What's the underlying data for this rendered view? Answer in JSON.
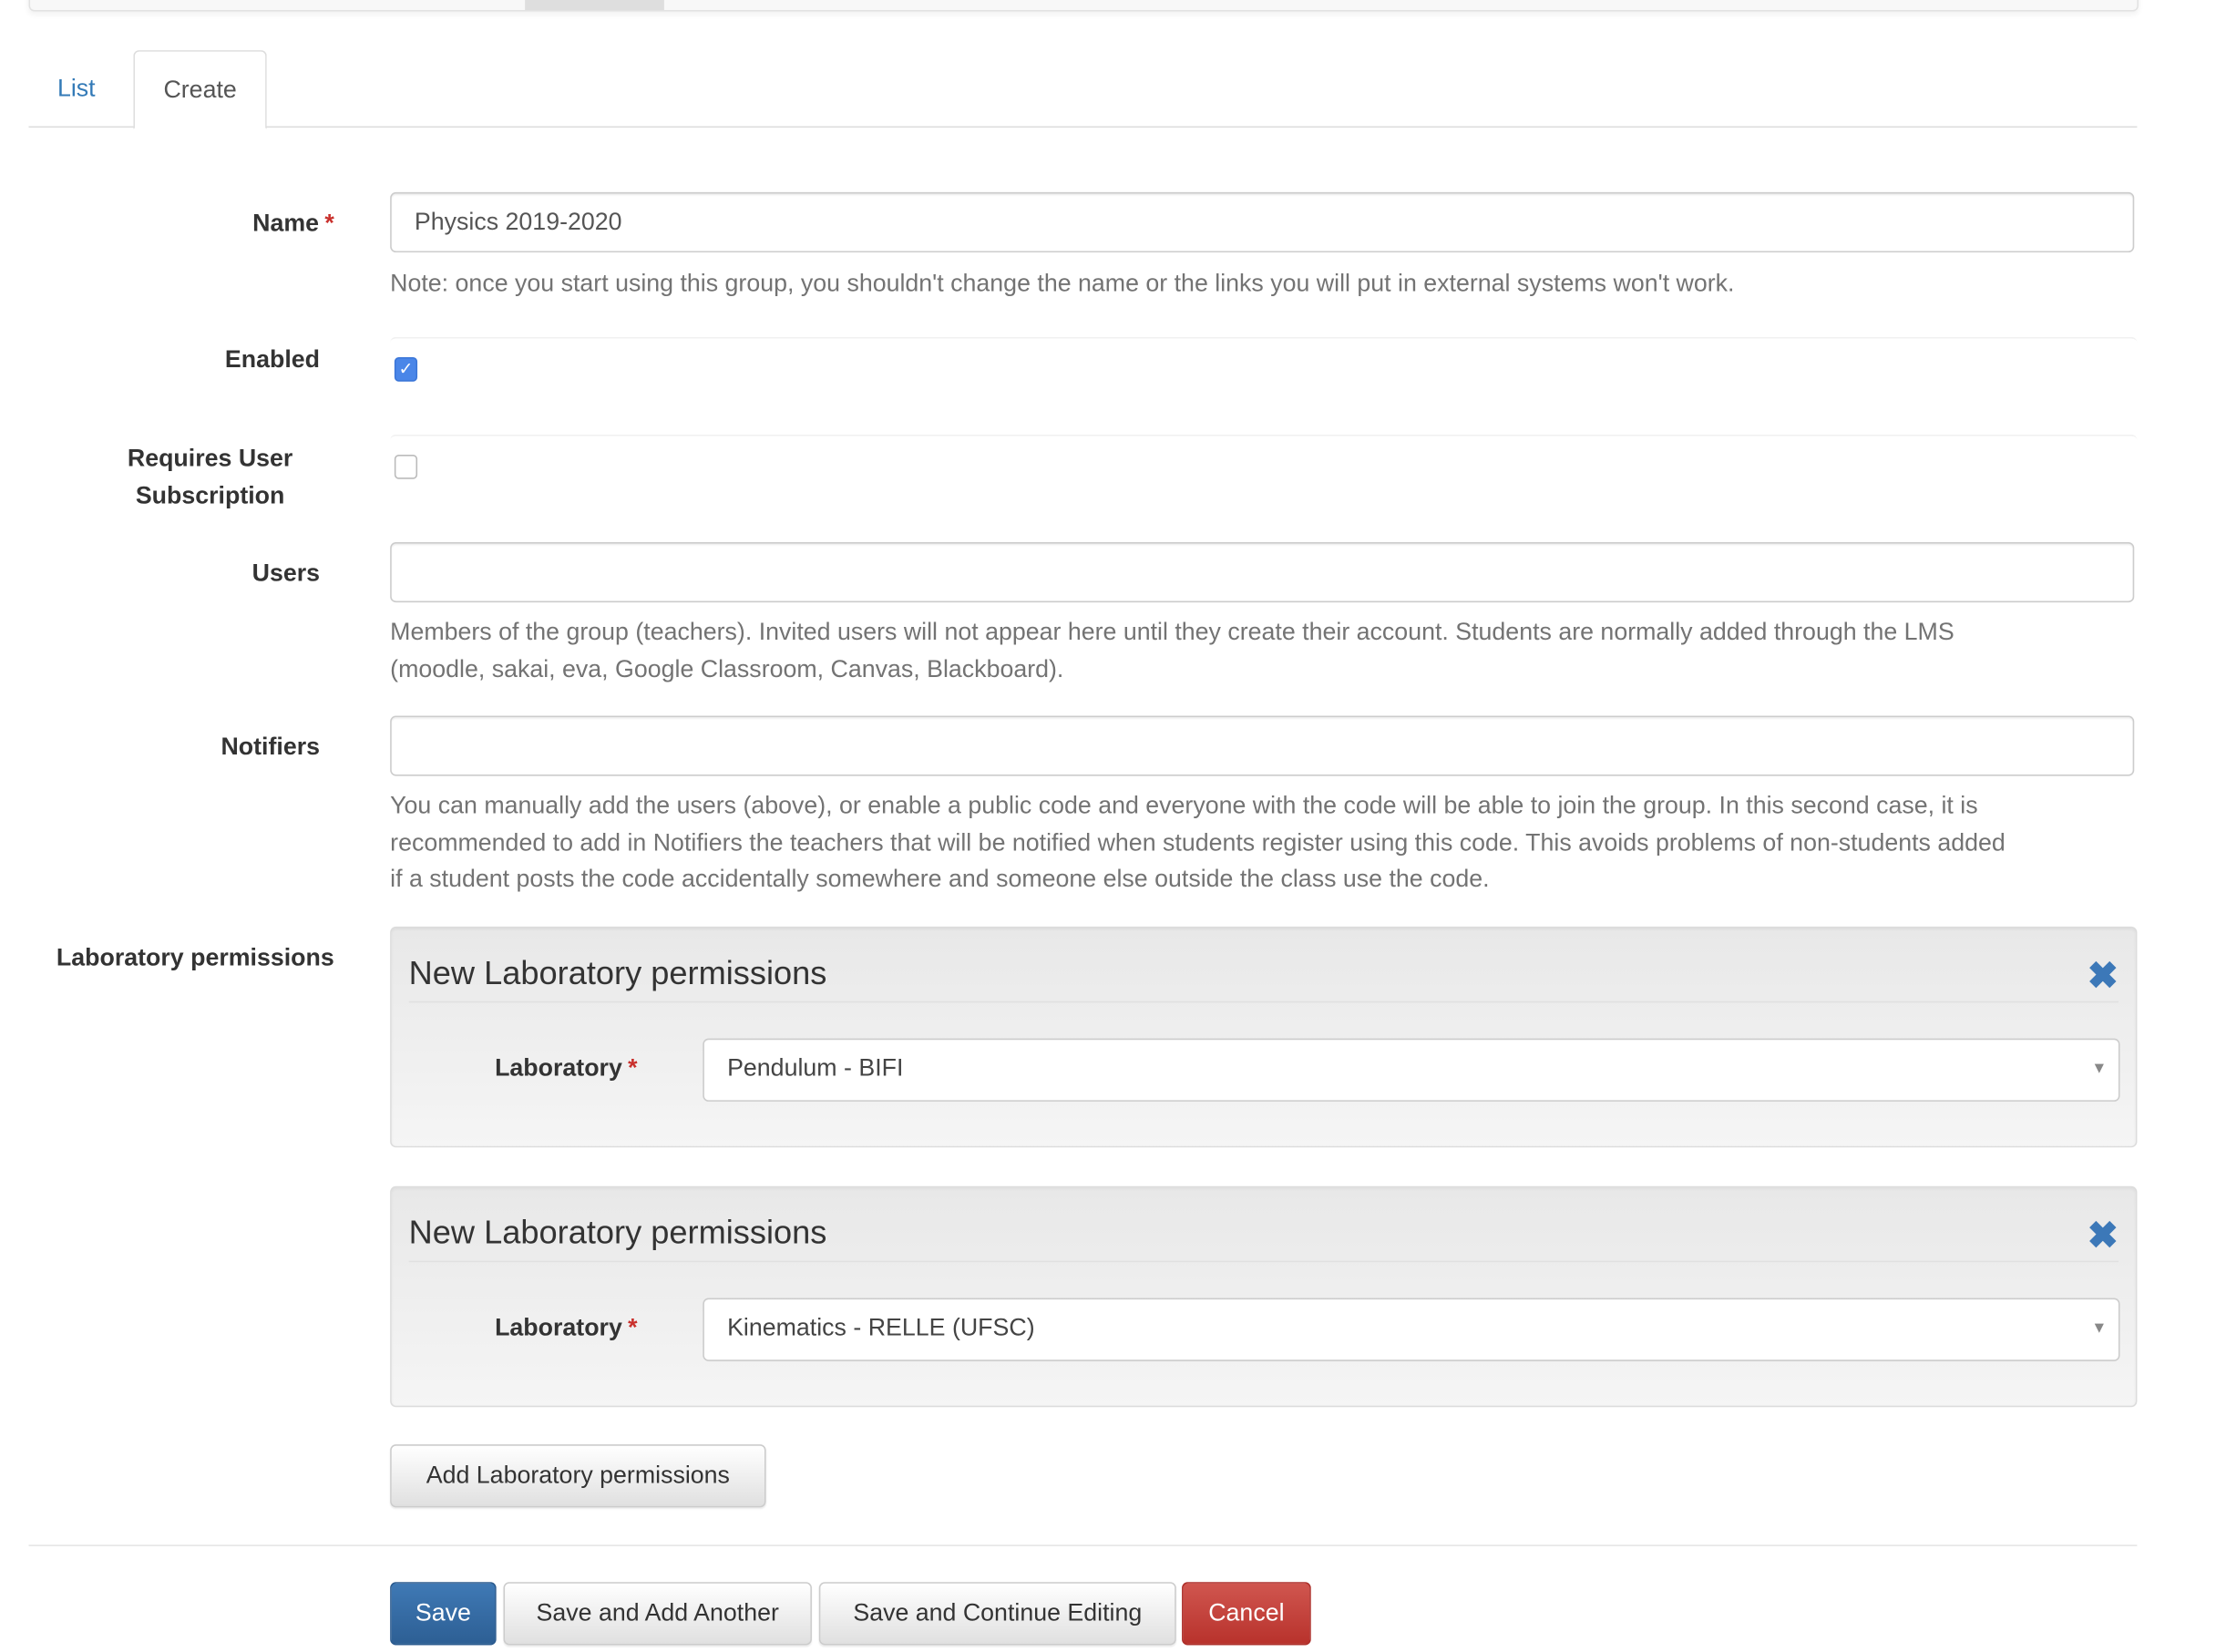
{
  "tabs": {
    "list": "List",
    "create": "Create"
  },
  "fields": {
    "name": {
      "label": "Name",
      "required": "*",
      "value": "Physics 2019-2020",
      "help": "Note: once you start using this group, you shouldn't change the name or the links you will put in external systems won't work."
    },
    "enabled": {
      "label": "Enabled",
      "checked": true
    },
    "requires_subscription": {
      "label_line1": "Requires User",
      "label_line2": "Subscription",
      "checked": false
    },
    "users": {
      "label": "Users",
      "value": "",
      "help_line1": "Members of the group (teachers). Invited users will not appear here until they create their account. Students are normally added through the LMS",
      "help_line2": "(moodle, sakai, eva, Google Classroom, Canvas, Blackboard)."
    },
    "notifiers": {
      "label": "Notifiers",
      "value": "",
      "help_line1": "You can manually add the users (above), or enable a public code and everyone with the code will be able to join the group. In this second case, it is",
      "help_line2": "recommended to add in Notifiers the teachers that will be notified when students register using this code. This avoids problems of non-students added",
      "help_line3": "if a student posts the code accidentally somewhere and someone else outside the class use the code."
    }
  },
  "lab_permissions": {
    "label": "Laboratory permissions",
    "items": [
      {
        "title": "New Laboratory permissions",
        "field_label": "Laboratory",
        "required": "*",
        "value": "Pendulum - BIFI"
      },
      {
        "title": "New Laboratory permissions",
        "field_label": "Laboratory",
        "required": "*",
        "value": "Kinematics - RELLE (UFSC)"
      }
    ],
    "add_label": "Add Laboratory permissions",
    "remove_icon": "✖",
    "caret_icon": "▼"
  },
  "actions": {
    "save": "Save",
    "save_add": "Save and Add Another",
    "save_continue": "Save and Continue Editing",
    "cancel": "Cancel"
  },
  "colors": {
    "primary": "#337ab7",
    "danger": "#c9302c",
    "checkbox": "#4a86e8"
  }
}
